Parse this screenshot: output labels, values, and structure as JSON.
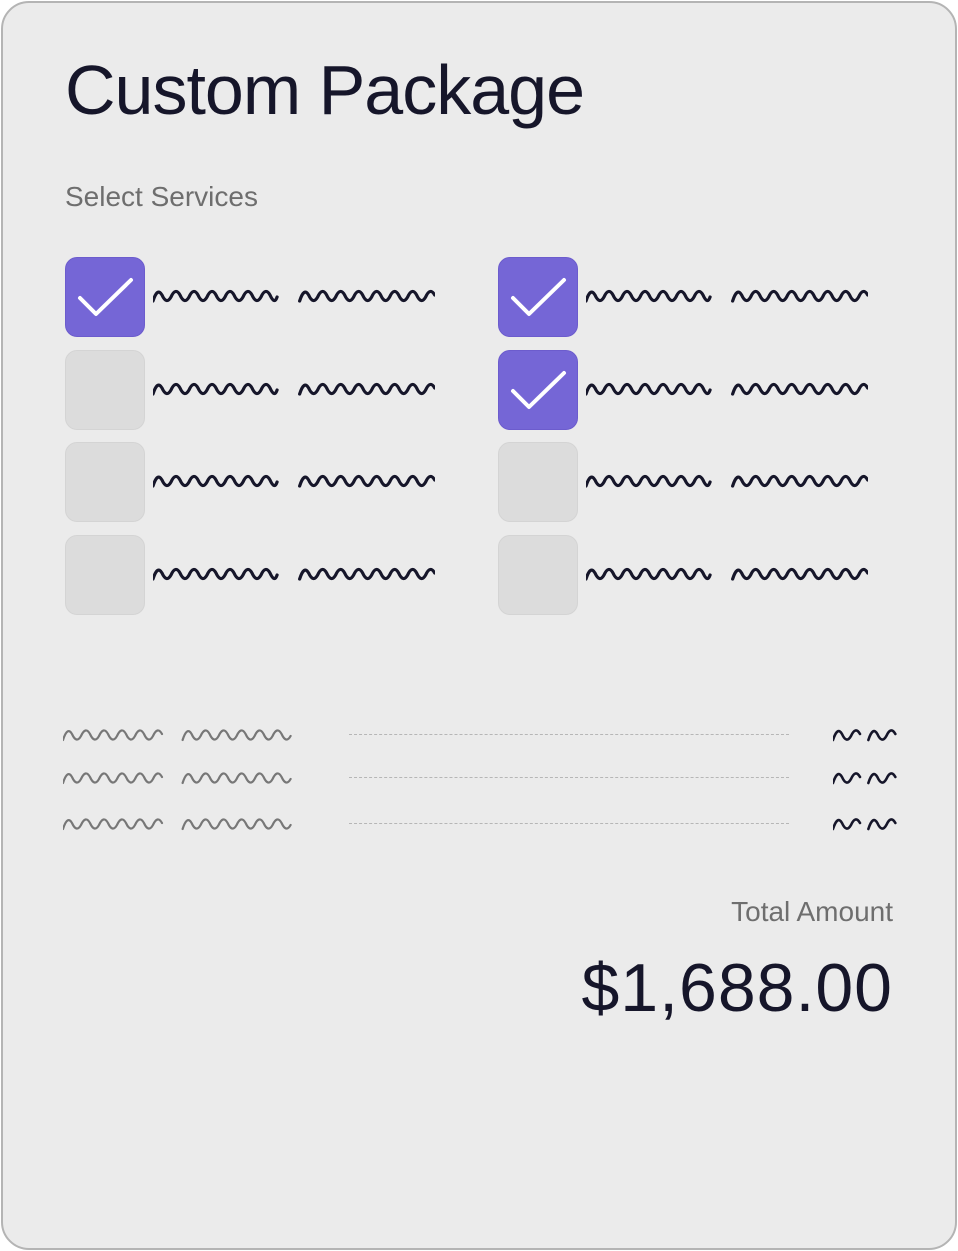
{
  "title": "Custom Package",
  "subtitle": "Select Services",
  "services": [
    {
      "checked": true
    },
    {
      "checked": false
    },
    {
      "checked": false
    },
    {
      "checked": false
    },
    {
      "checked": true
    },
    {
      "checked": true
    },
    {
      "checked": false
    },
    {
      "checked": false
    }
  ],
  "summary_line_count": 3,
  "total": {
    "label": "Total Amount",
    "value": "$1,688.00"
  },
  "colors": {
    "accent": "#7566d6",
    "card": "#ebebeb",
    "text": "#16162a",
    "muted": "#6e6e6e"
  },
  "icons": {
    "checkmark": "check-icon",
    "placeholder_text": "scribble-placeholder"
  }
}
